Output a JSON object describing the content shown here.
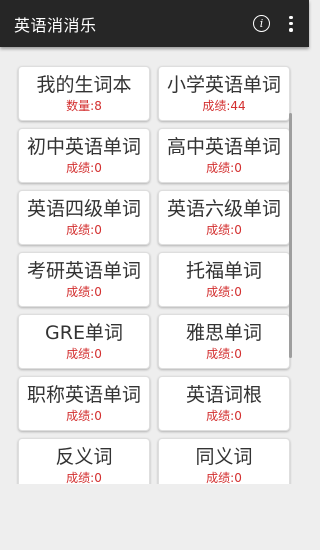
{
  "appbar": {
    "title": "英语消消乐",
    "info_icon": "i"
  },
  "colors": {
    "appbar": "#262626",
    "score": "#d32f2f",
    "background": "#eeeeee"
  },
  "cards": [
    {
      "title": "我的生词本",
      "sub": "数量:8"
    },
    {
      "title": "小学英语单词",
      "sub": "成绩:44"
    },
    {
      "title": "初中英语单词",
      "sub": "成绩:0"
    },
    {
      "title": "高中英语单词",
      "sub": "成绩:0"
    },
    {
      "title": "英语四级单词",
      "sub": "成绩:0"
    },
    {
      "title": "英语六级单词",
      "sub": "成绩:0"
    },
    {
      "title": "考研英语单词",
      "sub": "成绩:0"
    },
    {
      "title": "托福单词",
      "sub": "成绩:0"
    },
    {
      "title": "GRE单词",
      "sub": "成绩:0"
    },
    {
      "title": "雅思单词",
      "sub": "成绩:0"
    },
    {
      "title": "职称英语单词",
      "sub": "成绩:0"
    },
    {
      "title": "英语词根",
      "sub": "成绩:0"
    },
    {
      "title": "反义词",
      "sub": "成绩:0"
    },
    {
      "title": "同义词",
      "sub": "成绩:0"
    }
  ]
}
